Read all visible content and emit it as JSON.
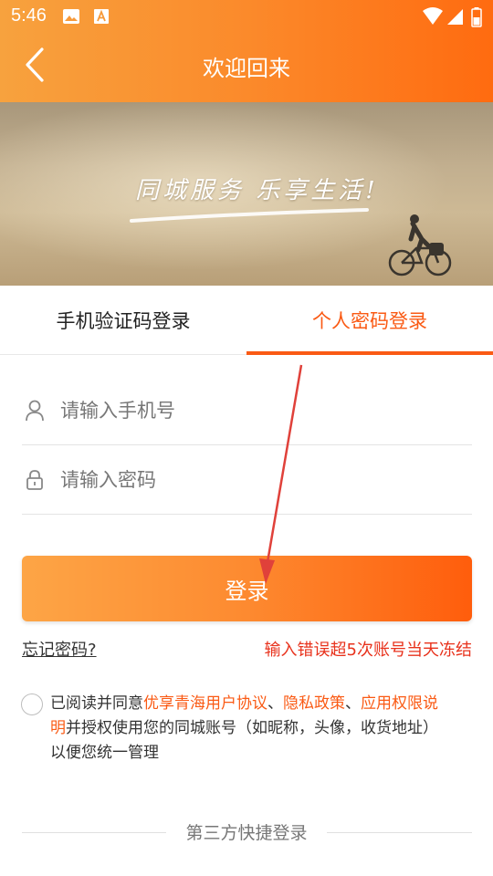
{
  "status_bar": {
    "time": "5:46"
  },
  "header": {
    "title": "欢迎回来"
  },
  "banner": {
    "slogan": "同城服务 乐享生活!"
  },
  "tabs": [
    {
      "label": "手机验证码登录",
      "active": false
    },
    {
      "label": "个人密码登录",
      "active": true
    }
  ],
  "form": {
    "phone_placeholder": "请输入手机号",
    "password_placeholder": "请输入密码",
    "login_label": "登录"
  },
  "forgot_label": "忘记密码?",
  "warning_text": "输入错误超5次账号当天冻结",
  "agreement": {
    "prefix": "已阅读并同意",
    "link_user": "优享青海用户协议",
    "sep1": "、",
    "link_privacy": "隐私政策",
    "sep2": "、",
    "link_permission": "应用权限说明",
    "suffix": "并授权使用您的同城账号（如昵称，头像，收货地址）以便您统一管理"
  },
  "third_party": {
    "label": "第三方快捷登录"
  },
  "colors": {
    "accent": "#fa5a14",
    "warning": "#e8321c",
    "header_start": "#f7a23e",
    "header_end": "#ff6b10"
  }
}
